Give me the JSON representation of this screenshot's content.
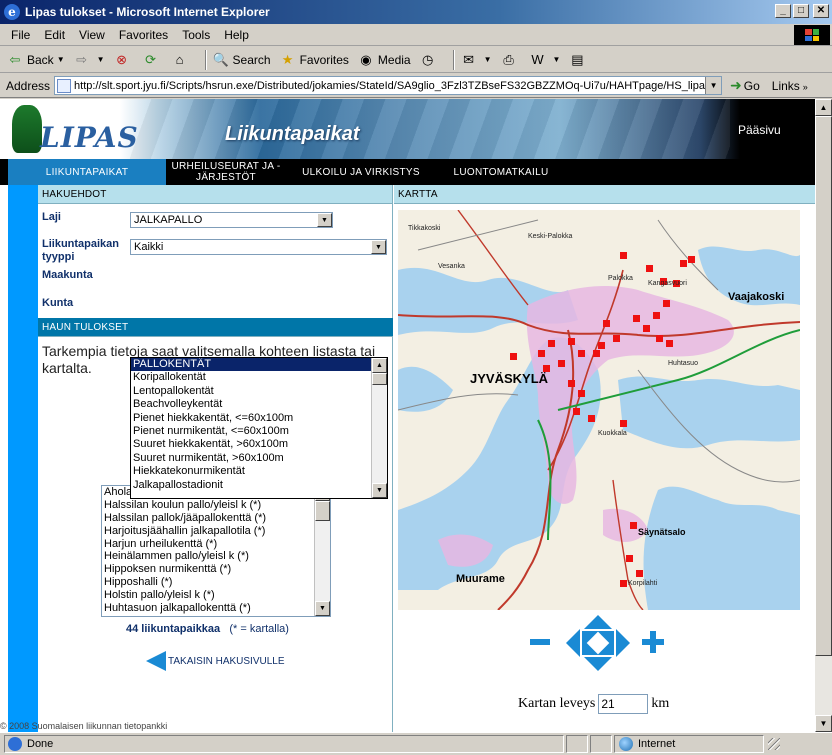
{
  "window": {
    "title": "Lipas tulokset - Microsoft Internet Explorer"
  },
  "menu": [
    "File",
    "Edit",
    "View",
    "Favorites",
    "Tools",
    "Help"
  ],
  "toolbar": {
    "back": "Back",
    "search": "Search",
    "favorites": "Favorites",
    "media": "Media"
  },
  "address": {
    "label": "Address",
    "url": "http://slt.sport.jyu.fi/Scripts/hsrun.exe/Distributed/jokamies/StateId/SA9glio_3Fzl3TZBseFS32GBZZMOq-Ui7u/HAHTpage/HS_lipas_ha",
    "go": "Go",
    "links": "Links"
  },
  "banner": {
    "logo": "LIPAS",
    "tagline": "Liikuntapaikat",
    "home": "Pääsivu"
  },
  "nav": [
    {
      "label": "LIIKUNTAPAIKAT"
    },
    {
      "label": "URHEILUSEURAT JA - JÄRJESTÖT"
    },
    {
      "label": "ULKOILU JA VIRKISTYS"
    },
    {
      "label": "LUONTOMATKAILU"
    }
  ],
  "search": {
    "header": "HAKUEHDOT",
    "laji_label": "Laji",
    "laji_value": "JALKAPALLO",
    "type_label": "Liikuntapaikan tyyppi",
    "type_value": "Kaikki",
    "maakunta_label": "Maakunta",
    "kunta_label": "Kunta",
    "type_options": [
      "PALLOKENTÄT",
      "Koripallokentät",
      "Lentopallokentät",
      "Beachvolleykentät",
      "Pienet hiekkakentät, <=60x100m",
      "Pienet nurmikentät, <=60x100m",
      "Suuret hiekkakentät, >60x100m",
      "Suuret nurmikentät, >60x100m",
      "Hiekkatekonurmikentät",
      "Jalkapallostadionit"
    ]
  },
  "results": {
    "header": "HAUN TULOKSET",
    "info": "Tarkempia tietoja saat valitsemalla kohteen listasta tai kartalta.",
    "items": [
      "Aholan",
      "Halssilan koulun pallo/yleisl k (*)",
      "Halssilan pallok/jääpallokenttä (*)",
      "Harjoitusjäähallin jalkapallotila (*)",
      "Harjun urheilukenttä (*)",
      "Heinälammen pallo/yleisl k (*)",
      "Hippoksen nurmikenttä (*)",
      "Hipposhalli (*)",
      "Holstin pallo/yleisl k (*)",
      "Huhtasuon jalkapallokenttä (*)"
    ],
    "count": "44 liikuntapaikkaa",
    "count_note": "(* = kartalla)",
    "back": "TAKAISIN HAKUSIVULLE"
  },
  "map": {
    "header": "KARTTA",
    "width_label": "Kartan leveys",
    "width_value": "21",
    "width_unit": "km",
    "places": [
      "JYVÄSKYLÄ",
      "Muurame",
      "Vaajakoski",
      "Säynätsalo",
      "Keski-Palokka",
      "Vesanka",
      "Palokka",
      "Kuokkala",
      "Tikkakoski",
      "Korpilahti",
      "Huhtasuo",
      "Kangasvuori"
    ]
  },
  "footer": "© 2008 Suomalaisen liikunnan tietopankki",
  "status": {
    "text": "Done",
    "zone": "Internet"
  }
}
